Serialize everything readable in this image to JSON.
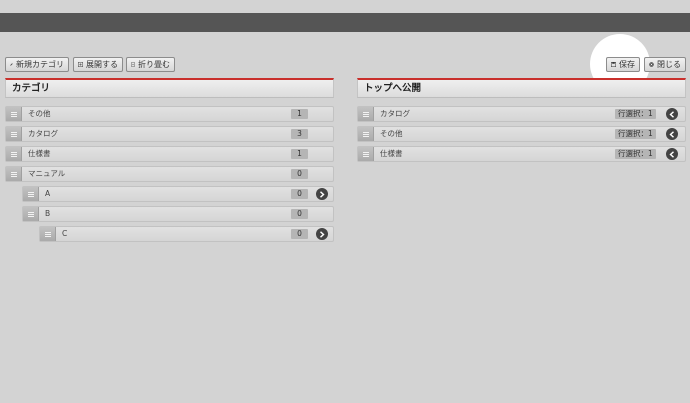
{
  "toolbar": {
    "new_category": "新規カテゴリ",
    "expand": "展開する",
    "collapse": "折り畳む",
    "save": "保存",
    "close": "閉じる"
  },
  "category_panel": {
    "title": "カテゴリ",
    "items": [
      {
        "label": "その他",
        "count": "1"
      },
      {
        "label": "カタログ",
        "count": "3"
      },
      {
        "label": "仕様書",
        "count": "1"
      },
      {
        "label": "マニュアル",
        "count": "0"
      },
      {
        "label": "A",
        "count": "0"
      },
      {
        "label": "B",
        "count": "0"
      },
      {
        "label": "C",
        "count": "0"
      }
    ]
  },
  "public_panel": {
    "title": "トップへ公開",
    "items": [
      {
        "label": "カタログ",
        "selection": "行選択：1"
      },
      {
        "label": "その他",
        "selection": "行選択：1"
      },
      {
        "label": "仕様書",
        "selection": "行選択：1"
      }
    ]
  },
  "colors": {
    "accent": "#c9302c",
    "topbar": "#555555",
    "background": "#d3d3d3"
  }
}
